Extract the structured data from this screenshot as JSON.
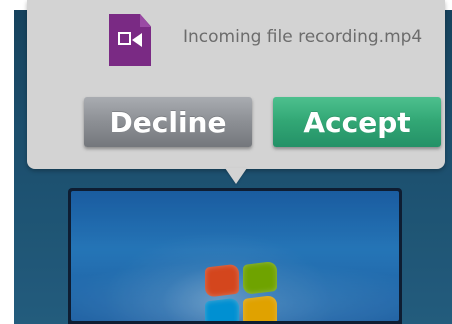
{
  "dialog": {
    "message": "Incoming file recording.mp4",
    "decline_label": "Decline",
    "accept_label": "Accept"
  },
  "icons": {
    "file": "video-file-icon"
  },
  "colors": {
    "dialog_bg": "#d3d3d3",
    "decline_button": "#8d9095",
    "accept_button": "#32a775",
    "file_icon": "#7a2a84",
    "background": "#1f587a"
  }
}
